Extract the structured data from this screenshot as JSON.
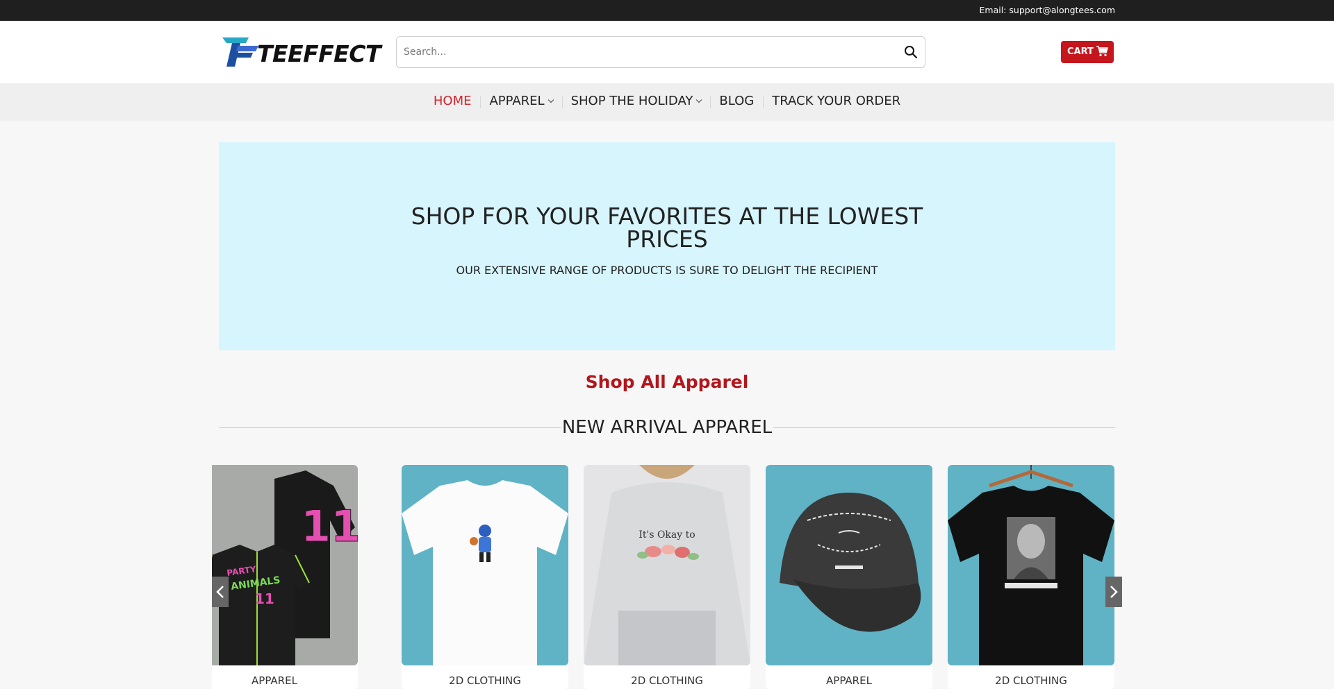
{
  "topbar": {
    "email": "Email: support@alongtees.com"
  },
  "header": {
    "logo_text": "TEEFFECT",
    "search_placeholder": "Search...",
    "cart_label": "CART"
  },
  "nav": {
    "items": [
      {
        "label": "HOME",
        "active": true,
        "dropdown": false
      },
      {
        "label": "APPAREL",
        "active": false,
        "dropdown": true
      },
      {
        "label": "SHOP THE HOLIDAY",
        "active": false,
        "dropdown": true
      },
      {
        "label": "BLOG",
        "active": false,
        "dropdown": false
      },
      {
        "label": "TRACK YOUR ORDER",
        "active": false,
        "dropdown": false
      }
    ]
  },
  "hero": {
    "title_line1": "SHOP FOR YOUR FAVORITES AT THE LOWEST",
    "title_line2": "PRICES",
    "subtitle": "OUR EXTENSIVE RANGE OF PRODUCTS IS SURE TO DELIGHT THE RECIPIENT"
  },
  "shop_all": "Shop All Apparel",
  "section_title": "NEW ARRIVAL APPAREL",
  "products": [
    {
      "category": "APPAREL",
      "image": "party-animals-baseball-jersey",
      "jersey_text": "PARTY ANIMALS",
      "jersey_number": "11"
    },
    {
      "category": "2D CLOTHING",
      "image": "white-tee-basketball-character"
    },
    {
      "category": "2D CLOTHING",
      "image": "grey-hoodie-floral-its-okay",
      "print_text": "It's Okay to"
    },
    {
      "category": "APPAREL",
      "image": "black-cap-pope-francis"
    },
    {
      "category": "2D CLOTHING",
      "image": "black-tee-portrait"
    }
  ],
  "colors": {
    "accent_red": "#c4161c",
    "hero_bg": "#d7f5fc",
    "topbar_bg": "#1f1f1f",
    "product_teal": "#5fb3c4"
  }
}
